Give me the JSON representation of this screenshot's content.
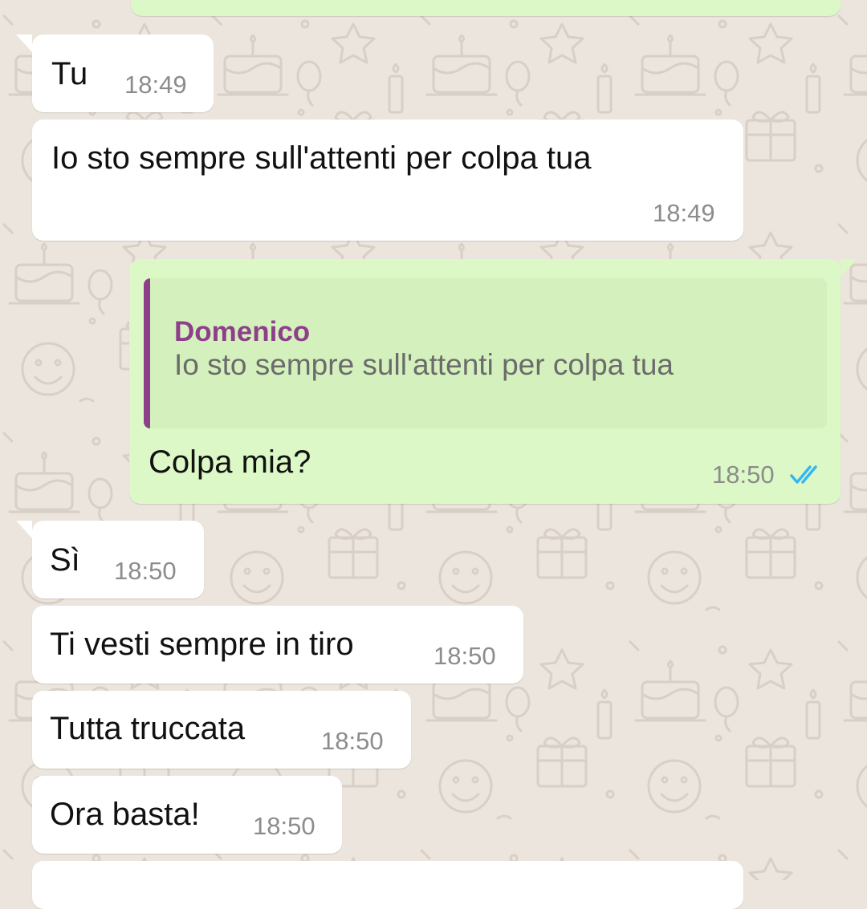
{
  "chat": {
    "messages": [
      {
        "direction": "outgoing",
        "text": "",
        "time": "",
        "partial": true
      },
      {
        "direction": "incoming",
        "text": "Tu",
        "time": "18:49"
      },
      {
        "direction": "incoming",
        "text": "Io sto sempre sull'attenti per colpa tua",
        "time": "18:49"
      },
      {
        "direction": "outgoing",
        "quote": {
          "author": "Domenico",
          "text": "Io sto sempre sull'attenti per colpa tua"
        },
        "text": "Colpa mia?",
        "time": "18:50",
        "status": "read"
      },
      {
        "direction": "incoming",
        "text": "Sì",
        "time": "18:50"
      },
      {
        "direction": "incoming",
        "text": "Ti vesti sempre in tiro",
        "time": "18:50"
      },
      {
        "direction": "incoming",
        "text": "Tutta truccata",
        "time": "18:50"
      },
      {
        "direction": "incoming",
        "text": "Ora basta!",
        "time": "18:50"
      },
      {
        "direction": "incoming",
        "text": "",
        "time": "",
        "partial": true
      }
    ]
  },
  "colors": {
    "background": "#ece5dd",
    "incoming_bubble": "#ffffff",
    "outgoing_bubble": "#dcf8c6",
    "quote_accent": "#8e3f8a",
    "read_ticks": "#34b7f1",
    "timestamp": "#8c8c8c"
  },
  "icons": {
    "read_status": "double-check-icon",
    "wallpaper": "party-doodle-pattern"
  }
}
